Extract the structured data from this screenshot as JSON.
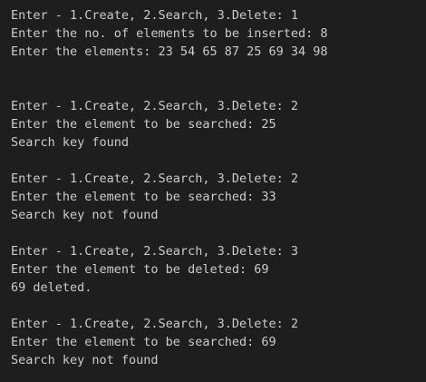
{
  "terminal": {
    "lines": [
      "Enter - 1.Create, 2.Search, 3.Delete: 1",
      "Enter the no. of elements to be inserted: 8",
      "Enter the elements: 23 54 65 87 25 69 34 98",
      "",
      "",
      "Enter - 1.Create, 2.Search, 3.Delete: 2",
      "Enter the element to be searched: 25",
      "Search key found",
      "",
      "Enter - 1.Create, 2.Search, 3.Delete: 2",
      "Enter the element to be searched: 33",
      "Search key not found",
      "",
      "Enter - 1.Create, 2.Search, 3.Delete: 3",
      "Enter the element to be deleted: 69",
      "69 deleted.",
      "",
      "Enter - 1.Create, 2.Search, 3.Delete: 2",
      "Enter the element to be searched: 69",
      "Search key not found"
    ]
  }
}
